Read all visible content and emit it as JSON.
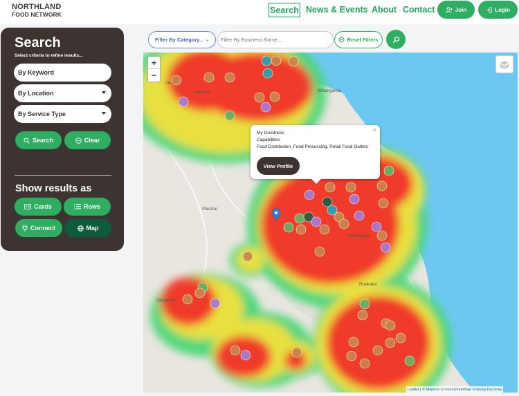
{
  "brand": {
    "line1": "NORTHLAND",
    "line2": "FOOD NETWORK"
  },
  "nav": {
    "search": "Search",
    "news": "News & Events",
    "about": "About",
    "contact": "Contact",
    "join": "Join",
    "login": "Login"
  },
  "sidebar": {
    "title": "Search",
    "subtitle": "Select criteria to refine results...",
    "keyword": "By Keyword",
    "location": "By Location",
    "service_type": "By Service Type",
    "search_button": "Search",
    "clear_button": "Clear",
    "show_results_title": "Show results as",
    "views": {
      "cards": "Cards",
      "rows": "Rows",
      "connect": "Connect",
      "map": "Map"
    },
    "active_view": "Map"
  },
  "filters": {
    "category": "Filter By Category...",
    "business_name_placeholder": "Filter By Business Name...",
    "reset": "Reset Filters"
  },
  "map": {
    "labels": [
      "Whangaroa",
      "Okaihau",
      "Kaikohe",
      "Pakotai",
      "Whangarei",
      "Dargaville",
      "Ruakaka"
    ],
    "popup": {
      "name": "My Goodness",
      "capabilities_title": "Capabilities",
      "capabilities": "Food Distribution, Food Processing, Retail Food Outlets",
      "button": "View Profile"
    },
    "attribution": {
      "leaflet": "Leaflet",
      "mapbox": "Mapbox",
      "osm": "OpenStreetMap",
      "improve": "Improve this map"
    },
    "colors": {
      "heat_core": "#f03a2c",
      "heat_mid": "#e7e040",
      "heat_outer": "#4cd676",
      "sea": "#6cc8f0",
      "land": "#e9e6e0"
    }
  }
}
